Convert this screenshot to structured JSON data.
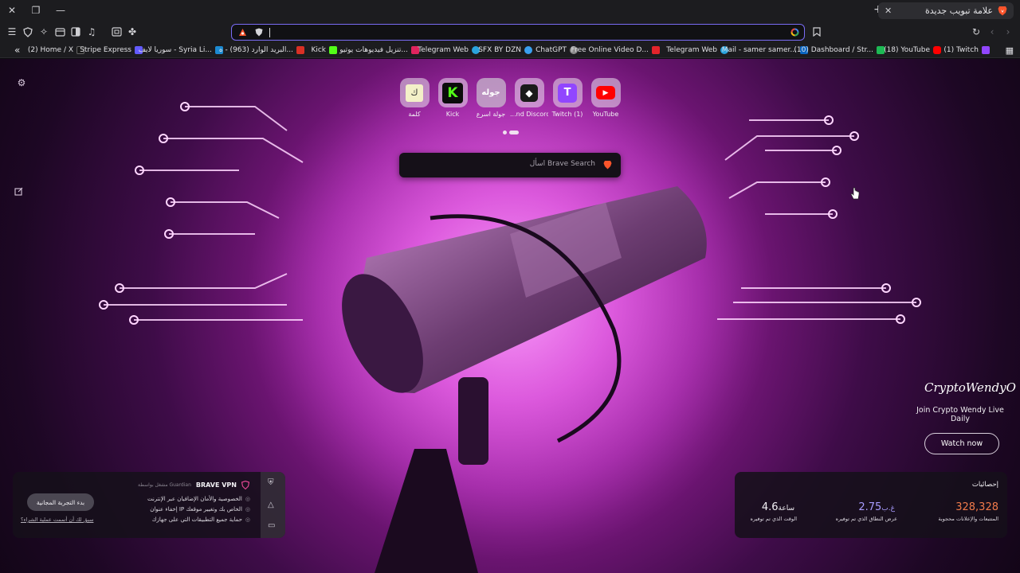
{
  "window": {
    "tab_title": "علامة تبويب جديدة",
    "close_glyph": "✕",
    "restore_glyph": "❐",
    "minimize_glyph": "—",
    "newtab_glyph": "+"
  },
  "bookmarks": [
    {
      "label": "(2) Home / X",
      "color": "#1a1a1a"
    },
    {
      "label": "Stripe Express",
      "color": "#635bff"
    },
    {
      "label": "سوريا لايف - Syria Li...",
      "color": "#1c8ad1"
    },
    {
      "label": "البريد الوارد (963) - ه...",
      "color": "#d93025"
    },
    {
      "label": "Kick",
      "color": "#53fc18"
    },
    {
      "label": "تنزيل فيديوهات يوتيو...",
      "color": "#e0245e"
    },
    {
      "label": "Telegram Web",
      "color": "#2aa3de"
    },
    {
      "label": "SFX BY DZN",
      "color": "#3aa0f0"
    },
    {
      "label": "ChatGPT",
      "color": "#8e8e8e"
    },
    {
      "label": "Free Online Video D...",
      "color": "#e3242b"
    },
    {
      "label": "Telegram Web",
      "color": "#2aa3de"
    },
    {
      "label": "Mail - samer samer...",
      "color": "#0a66c2"
    },
    {
      "label": "(10) Dashboard / Str...",
      "color": "#1db954"
    },
    {
      "label": "(18) YouTube",
      "color": "#ff0000"
    },
    {
      "label": "(1) Twitch",
      "color": "#9146ff"
    }
  ],
  "top_sites": [
    {
      "label": "كلمة",
      "glyph": "ك"
    },
    {
      "label": "Kick",
      "glyph": "K"
    },
    {
      "label": "جولة اسرع",
      "glyph": "جوله"
    },
    {
      "label": "...nd Discord",
      "glyph": "◆"
    },
    {
      "label": "Twitch (1)",
      "glyph": "T"
    },
    {
      "label": "YouTube",
      "glyph": "▶"
    }
  ],
  "search": {
    "placeholder": "اسأل Brave Search"
  },
  "promo": {
    "title": "CryptoWendyO",
    "subtitle": "Join Crypto Wendy Live Daily",
    "button": "Watch now"
  },
  "vpn": {
    "title": "BRAVE VPN",
    "powered_by": "مشغل بواسطة Guardian",
    "features": [
      "الخصوصية والأمان الإضافيان عبر الإنترنت",
      "إخفاء عنوان IP الخاص بك وتغيير موقعك",
      "حماية جميع التطبيقات التي على جهازك"
    ],
    "trial_button": "بدء التجربة المجانية",
    "purchased_link": "سبق لك أن أتممت عملية الشراء؟"
  },
  "stats": {
    "title": "إحصائيات",
    "items": [
      {
        "value": "328,328",
        "unit": "",
        "label": "المتتبعات والإعلانات محجوبة",
        "color": "#f07a4a"
      },
      {
        "value": "2.75",
        "unit": "غ.ب",
        "label": "عرض النطاق الذي تم توفيره",
        "color": "#a89cff"
      },
      {
        "value": "4.6",
        "unit": "ساعة",
        "label": "الوقت الذي تم توفيره",
        "color": "#f2f0f4"
      }
    ]
  },
  "colors": {
    "url_focus": "#7a6cf5",
    "brave_orange": "#fb542b"
  }
}
